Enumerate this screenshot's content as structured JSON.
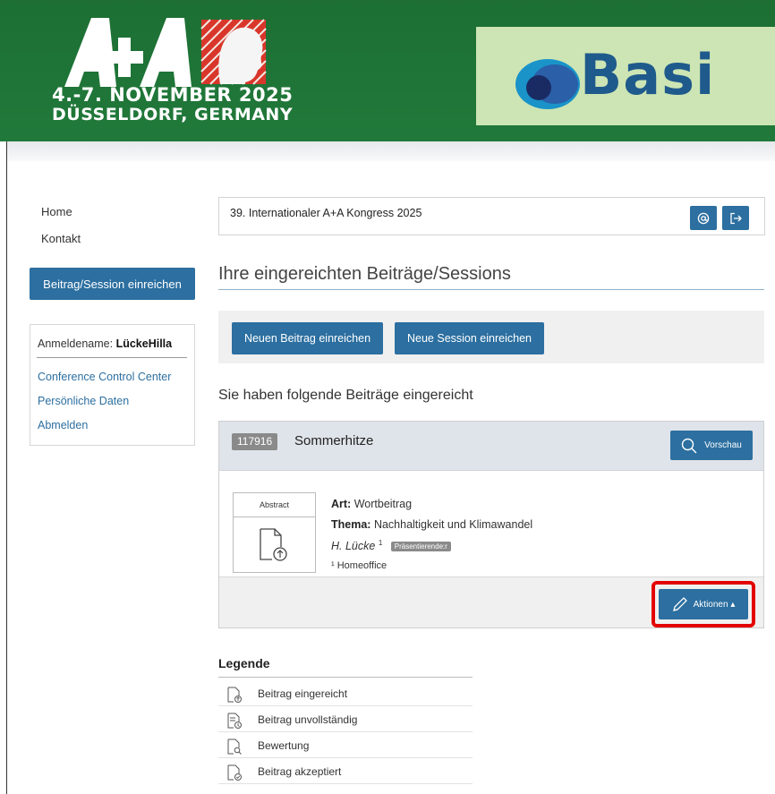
{
  "banner": {
    "logo_text": "A+A",
    "date_line": "4.-7. NOVEMBER 2025",
    "location_line": "DÜSSELDORF, GERMANY",
    "sponsor_name": "Basi"
  },
  "nav": {
    "home": "Home",
    "contact": "Kontakt",
    "submit_button": "Beitrag/Session einreichen",
    "login_label": "Anmeldename:",
    "login_user": "LückeHilla",
    "links": [
      "Conference Control Center",
      "Persönliche Daten",
      "Abmelden"
    ]
  },
  "congress": {
    "title": "39. Internationaler A+A Kongress 2025"
  },
  "page": {
    "title": "Ihre eingereichten Beiträge/Sessions",
    "new_submission": "Neuen Beitrag einreichen",
    "new_session": "Neue Session einreichen",
    "section_title": "Sie haben folgende Beiträge eingereicht"
  },
  "submission": {
    "id": "117916",
    "name": "Sommerhitze",
    "preview_button": "Vorschau",
    "abstract_label": "Abstract",
    "type_label": "Art:",
    "type_value": "Wortbeitrag",
    "topic_label": "Thema:",
    "topic_value": "Nachhaltigkeit und Klimawandel",
    "author": "H. Lücke",
    "author_sup": "1",
    "presenter_badge": "Präsentierende:r",
    "affiliation": "¹ Homeoffice",
    "actions_button": "Aktionen ▴"
  },
  "legend": {
    "title": "Legende",
    "items": [
      "Beitrag eingereicht",
      "Beitrag unvollständig",
      "Bewertung",
      "Beitrag akzeptiert"
    ]
  },
  "colors": {
    "primary": "#2c6fa0",
    "banner_green": "#1e7034",
    "highlight_red": "#e30000"
  }
}
